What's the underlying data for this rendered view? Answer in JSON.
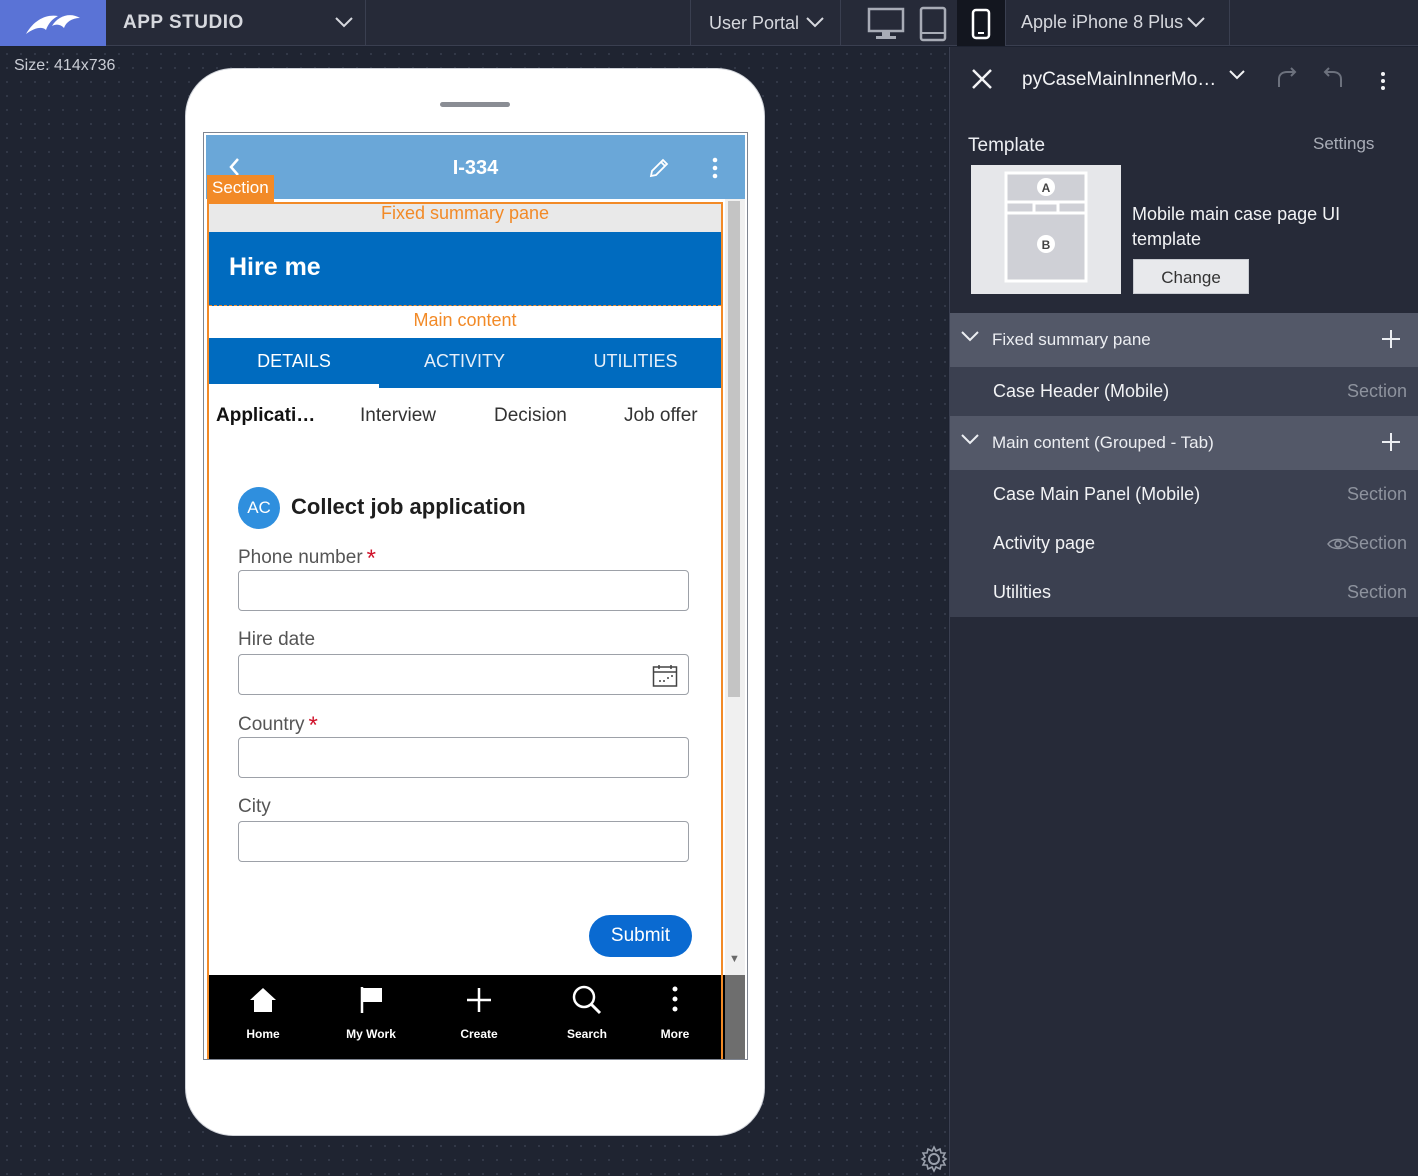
{
  "topbar": {
    "app_title": "APP STUDIO",
    "portal": "User Portal",
    "device": "Apple iPhone 8 Plus",
    "device_modes": [
      "desktop-icon",
      "tablet-icon",
      "mobile-icon"
    ],
    "active_mode": "mobile-icon"
  },
  "canvas": {
    "size_label": "Size: 414x736"
  },
  "preview": {
    "case_id": "I-334",
    "section_tag": "Section",
    "fixed_summary_label": "Fixed summary pane",
    "hire_title": "Hire me",
    "main_content_label": "Main content",
    "tabs": [
      {
        "label": "DETAILS",
        "active": true
      },
      {
        "label": "ACTIVITY",
        "active": false
      },
      {
        "label": "UTILITIES",
        "active": false
      }
    ],
    "stages": [
      {
        "label": "Applicati…",
        "active": true
      },
      {
        "label": "Interview",
        "active": false
      },
      {
        "label": "Decision",
        "active": false
      },
      {
        "label": "Job offer",
        "active": false
      }
    ],
    "avatar_initials": "AC",
    "assignment_title": "Collect job application",
    "fields": [
      {
        "label": "Phone number",
        "required": true,
        "value": ""
      },
      {
        "label": "Hire date",
        "required": false,
        "value": ""
      },
      {
        "label": "Country",
        "required": true,
        "value": ""
      },
      {
        "label": "City",
        "required": false,
        "value": ""
      }
    ],
    "required_marker": "*",
    "submit_label": "Submit",
    "nav": [
      {
        "label": "Home",
        "icon": "home-icon"
      },
      {
        "label": "My Work",
        "icon": "flag-icon"
      },
      {
        "label": "Create",
        "icon": "plus-icon"
      },
      {
        "label": "Search",
        "icon": "search-icon"
      },
      {
        "label": "More",
        "icon": "more-icon"
      }
    ]
  },
  "panel": {
    "title": "pyCaseMainInnerMo…",
    "template_label": "Template",
    "settings_label": "Settings",
    "thumb_regions": [
      "A",
      "B"
    ],
    "template_desc": "Mobile main case page UI template",
    "change_label": "Change",
    "groups": [
      {
        "label": "Fixed summary pane",
        "items": [
          {
            "label": "Case Header (Mobile)",
            "type": "Section",
            "eye": false
          }
        ]
      },
      {
        "label": "Main content (Grouped - Tab)",
        "items": [
          {
            "label": "Case Main Panel (Mobile)",
            "type": "Section",
            "eye": false
          },
          {
            "label": "Activity page",
            "type": "Section",
            "eye": true
          },
          {
            "label": "Utilities",
            "type": "Section",
            "eye": false
          }
        ]
      }
    ]
  },
  "colors": {
    "accent_blue": "#006bbf",
    "header_blue": "#6aa7d8",
    "section_orange": "#f28a27",
    "required_red": "#d0132b",
    "logo_bg": "#5a73d6"
  }
}
